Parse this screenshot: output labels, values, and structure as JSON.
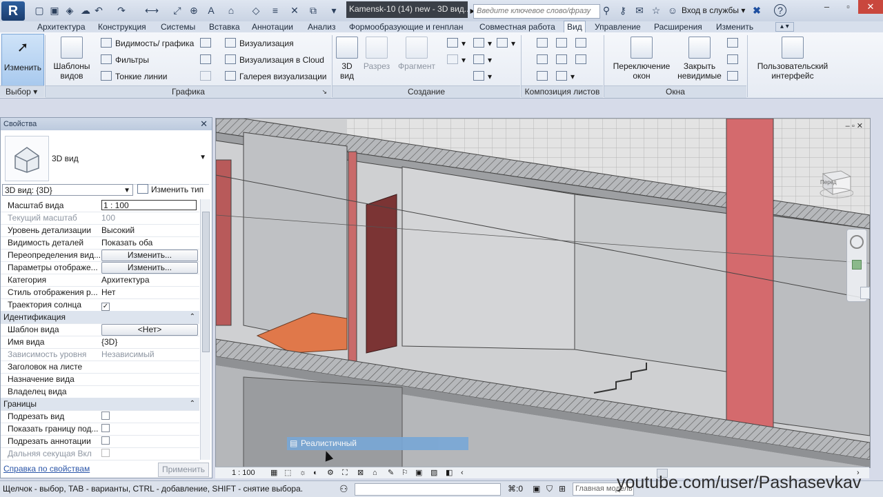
{
  "titlebar": {
    "logo": "R",
    "doc_title": "Kamensk-10 (14) new - 3D вид...",
    "search_placeholder": "Введите ключевое слово/фразу",
    "login": "Вход в службы",
    "help": "?"
  },
  "tabs": [
    {
      "label": "Архитектура"
    },
    {
      "label": "Конструкция"
    },
    {
      "label": "Системы"
    },
    {
      "label": "Вставка"
    },
    {
      "label": "Аннотации"
    },
    {
      "label": "Анализ"
    },
    {
      "label": "Формообразующие и генплан"
    },
    {
      "label": "Совместная работа"
    },
    {
      "label": "Вид"
    },
    {
      "label": "Управление"
    },
    {
      "label": "Расширения"
    },
    {
      "label": "Изменить"
    }
  ],
  "ribbon": {
    "modify": "Изменить",
    "select_panel": "Выбор",
    "view_templates": "Шаблоны видов",
    "graphics_items": [
      "Видимость/ графика",
      "Фильтры",
      "Тонкие линии"
    ],
    "render_items": [
      "Визуализация",
      "Визуализация в Cloud",
      "Галерея визуализации"
    ],
    "graphics_panel": "Графика",
    "view3d": "3D вид",
    "section": "Разрез",
    "callout": "Фрагмент",
    "create_panel": "Создание",
    "sheet_panel": "Композиция листов",
    "switch_windows": "Переключение окон",
    "close_hidden": "Закрыть невидимые",
    "user_interface": "Пользовательский интерфейс",
    "windows_panel": "Окна"
  },
  "properties": {
    "header": "Свойства",
    "type_name": "3D вид",
    "view_selector": "3D вид: {3D}",
    "edit_type": "Изменить тип",
    "rows": [
      {
        "k": "Масштаб вида",
        "v": "1 : 100"
      },
      {
        "k": "Текущий масштаб",
        "v": "100"
      },
      {
        "k": "Уровень детализации",
        "v": "Высокий"
      },
      {
        "k": "Видимость деталей",
        "v": "Показать оба"
      },
      {
        "k": "Переопределения вид...",
        "v": "Изменить..."
      },
      {
        "k": "Параметры отображе...",
        "v": "Изменить..."
      },
      {
        "k": "Категория",
        "v": "Архитектура"
      },
      {
        "k": "Стиль отображения р...",
        "v": "Нет"
      },
      {
        "k": "Траектория солнца",
        "v": "✓"
      },
      {
        "k": "Идентификация",
        "v": ""
      },
      {
        "k": "Шаблон вида",
        "v": "<Нет>"
      },
      {
        "k": "Имя вида",
        "v": "{3D}"
      },
      {
        "k": "Зависимость уровня",
        "v": "Независимый"
      },
      {
        "k": "Заголовок на листе",
        "v": ""
      },
      {
        "k": "Назначение вида",
        "v": ""
      },
      {
        "k": "Владелец вида",
        "v": ""
      },
      {
        "k": "Границы",
        "v": ""
      },
      {
        "k": "Подрезать вид",
        "v": ""
      },
      {
        "k": "Показать границу под...",
        "v": ""
      },
      {
        "k": "Подрезать аннотации",
        "v": ""
      },
      {
        "k": "Дальняя секущая Вкл",
        "v": ""
      }
    ],
    "help_link": "Справка по свойствам",
    "apply": "Применить"
  },
  "viewport": {
    "scale": "1 : 100",
    "tooltip": "Реалистичный",
    "viewcube_label": "Перед",
    "zero_label": ":0"
  },
  "statusbar": {
    "hint": "Щелчок - выбор, TAB - варианты, CTRL - добавление, SHIFT - снятие выбора.",
    "model": "Главная модель",
    "watermark": "youtube.com/user/Pashasevkav"
  }
}
